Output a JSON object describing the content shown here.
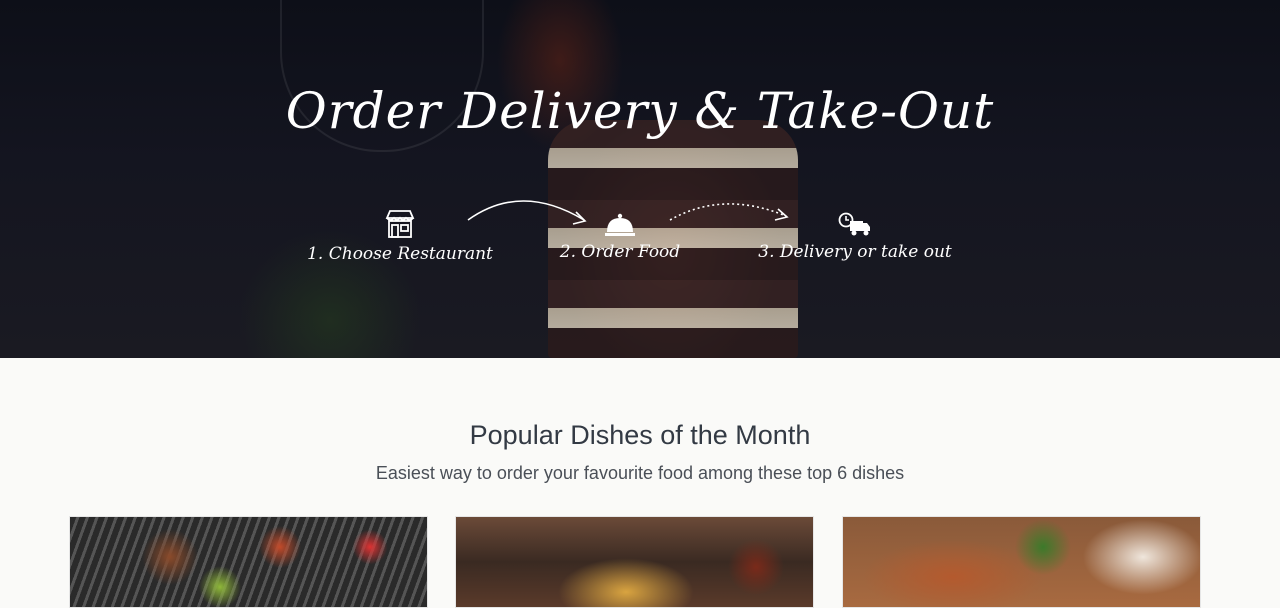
{
  "hero": {
    "title": "Order Delivery & Take-Out",
    "steps": [
      {
        "label": "1. Choose Restaurant",
        "icon": "storefront-icon"
      },
      {
        "label": "2. Order Food",
        "icon": "food-cloche-icon"
      },
      {
        "label": "3. Delivery or take out",
        "icon": "delivery-truck-icon"
      }
    ]
  },
  "popular": {
    "title": "Popular Dishes of the Month",
    "subtitle": "Easiest way to order your favourite food among these top 6 dishes"
  },
  "colors": {
    "hero_text": "#ffffff",
    "section_bg": "#fafaf8",
    "heading": "#333a44"
  }
}
